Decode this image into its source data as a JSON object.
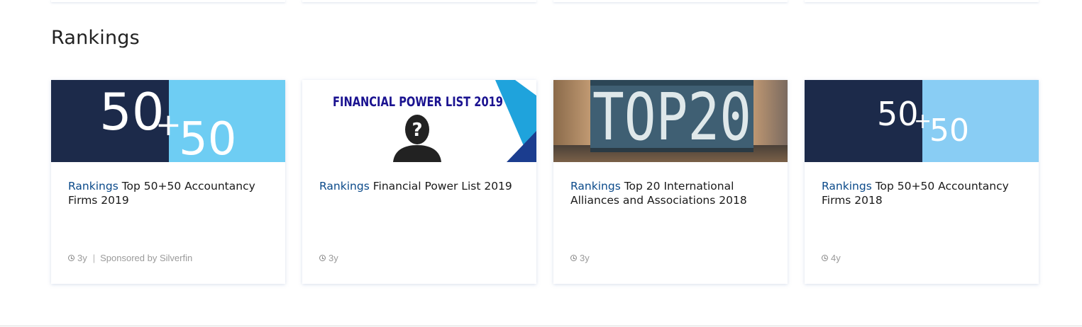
{
  "section": {
    "title": "Rankings"
  },
  "cards": [
    {
      "image_text": [
        "50",
        "+",
        "50"
      ],
      "category": "Rankings",
      "title": "Top 50+50 Accountancy Firms 2019",
      "age": "3y",
      "separator": "|",
      "sponsor": "Sponsored by Silverfin"
    },
    {
      "image_text": [
        "FINANCIAL POWER LIST 2019",
        "?"
      ],
      "category": "Rankings",
      "title": "Financial Power List 2019",
      "age": "3y"
    },
    {
      "image_text": [
        "TOP",
        "20"
      ],
      "category": "Rankings",
      "title": "Top 20 International Alliances and Associations 2018",
      "age": "3y"
    },
    {
      "image_text": [
        "50",
        "+",
        "50"
      ],
      "category": "Rankings",
      "title": "Top 50+50 Accountancy Firms 2018",
      "age": "4y"
    }
  ],
  "colors": {
    "navy": "#1c2a4a",
    "light_blue": "#6ecdf3",
    "pale_blue": "#89cdf4",
    "category_link": "#0b4a8a",
    "power_list_text": "#1a1290",
    "meta_grey": "#9a9a9a"
  },
  "icons": {
    "age": "clock-icon"
  }
}
